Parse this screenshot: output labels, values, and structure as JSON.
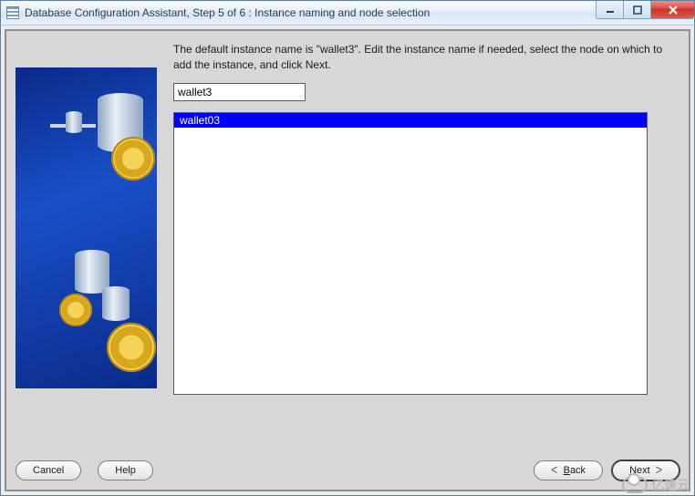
{
  "window": {
    "title": "Database Configuration Assistant, Step 5 of 6 : Instance naming and node selection"
  },
  "main": {
    "instruction": "The default instance name is \"wallet3\". Edit the instance name if needed, select the node on which to add the instance, and click Next.",
    "instance_value": "wallet3",
    "nodes": [
      "wallet03"
    ],
    "selected_node_index": 0
  },
  "buttons": {
    "cancel": "Cancel",
    "help": "Help",
    "back": "Back",
    "next": "Next"
  },
  "watermark": "亿速云"
}
